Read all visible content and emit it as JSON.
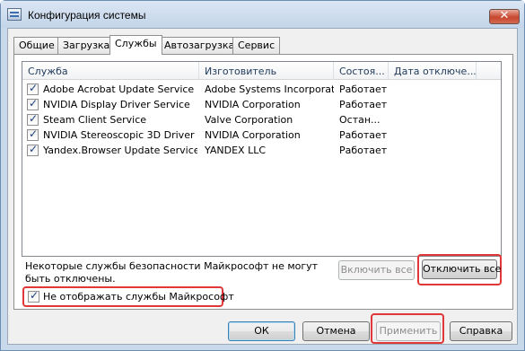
{
  "window": {
    "title": "Конфигурация системы",
    "close_glyph": "✕"
  },
  "tabs": [
    {
      "label": "Общие",
      "active": false
    },
    {
      "label": "Загрузка",
      "active": false
    },
    {
      "label": "Службы",
      "active": true
    },
    {
      "label": "Автозагрузка",
      "active": false
    },
    {
      "label": "Сервис",
      "active": false
    }
  ],
  "services": {
    "columns": [
      "Служба",
      "Изготовитель",
      "Состоя...",
      "Дата отключе..."
    ],
    "rows": [
      {
        "checked": true,
        "name": "Adobe Acrobat Update Service",
        "maker": "Adobe Systems Incorporated",
        "status": "Работает",
        "date": ""
      },
      {
        "checked": true,
        "name": "NVIDIA Display Driver Service",
        "maker": "NVIDIA Corporation",
        "status": "Работает",
        "date": ""
      },
      {
        "checked": true,
        "name": "Steam Client Service",
        "maker": "Valve Corporation",
        "status": "Остан...",
        "date": ""
      },
      {
        "checked": true,
        "name": "NVIDIA Stereoscopic 3D Driver S...",
        "maker": "NVIDIA Corporation",
        "status": "Работает",
        "date": ""
      },
      {
        "checked": true,
        "name": "Yandex.Browser Update Service",
        "maker": "YANDEX LLC",
        "status": "Работает",
        "date": ""
      }
    ]
  },
  "note": "Некоторые службы безопасности Майкрософт не могут быть отключены.",
  "buttons": {
    "enable_all": "Включить все",
    "disable_all": "Отключить все",
    "ok": "ОК",
    "cancel": "Отмена",
    "apply": "Применить",
    "help": "Справка"
  },
  "hide_ms": {
    "label": "Не отображать службы Майкрософт",
    "checked": true
  },
  "colors": {
    "highlight": "#e03838",
    "titlebar": "#c9d9ec"
  }
}
